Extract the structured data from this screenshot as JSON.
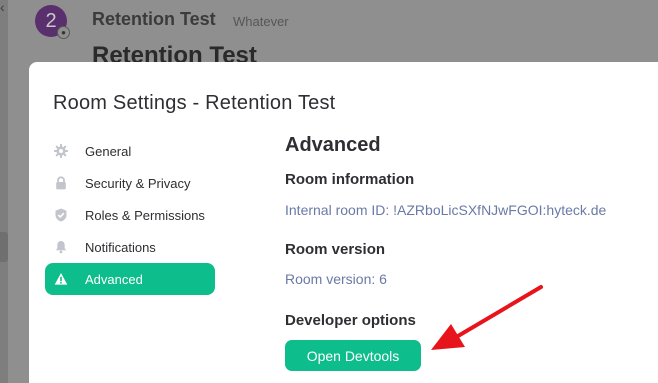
{
  "background": {
    "avatar_letter": "2",
    "room_name": "Retention Test",
    "room_topic": "Whatever",
    "room_heading": "Retention Test"
  },
  "dialog": {
    "title": "Room Settings - Retention Test",
    "tabs": [
      {
        "label": "General",
        "icon": "gear-icon"
      },
      {
        "label": "Security & Privacy",
        "icon": "lock-icon"
      },
      {
        "label": "Roles & Permissions",
        "icon": "shield-check-icon"
      },
      {
        "label": "Notifications",
        "icon": "bell-icon"
      },
      {
        "label": "Advanced",
        "icon": "warning-icon",
        "active": true
      }
    ],
    "content": {
      "heading": "Advanced",
      "room_information_heading": "Room information",
      "internal_room_id": "Internal room ID: !AZRboLicSXfNJwFGOI:hyteck.de",
      "room_version_heading": "Room version",
      "room_version": "Room version: 6",
      "developer_options_heading": "Developer options",
      "open_devtools_label": "Open Devtools"
    }
  },
  "colors": {
    "accent": "#0dbd8b",
    "annotation_arrow": "#e8141b"
  }
}
